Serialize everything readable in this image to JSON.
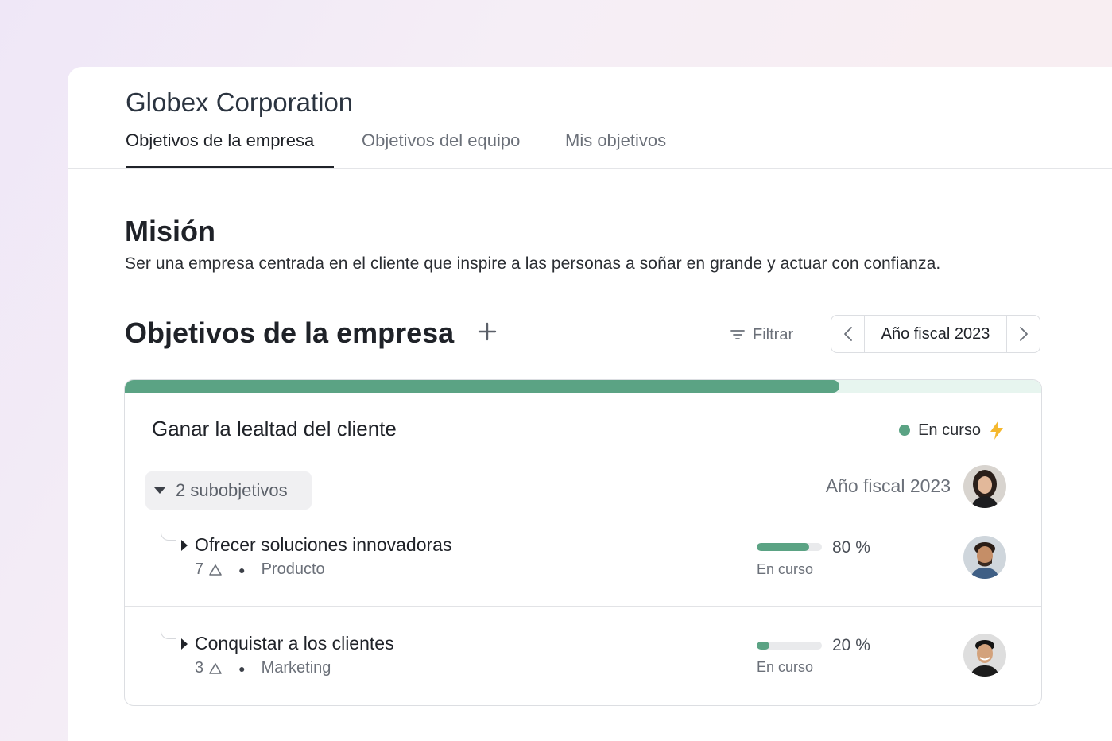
{
  "header": {
    "company": "Globex Corporation",
    "tabs": [
      {
        "label": "Objetivos de la empresa",
        "active": true
      },
      {
        "label": "Objetivos del equipo",
        "active": false
      },
      {
        "label": "Mis objetivos",
        "active": false
      }
    ]
  },
  "mission": {
    "title": "Misión",
    "text": "Ser una empresa centrada en el cliente que inspire a las personas a soñar en grande y actuar con confianza."
  },
  "goals_section": {
    "title": "Objetivos de la empresa",
    "add_icon": "plus-icon",
    "filter_label": "Filtrar",
    "filter_icon": "filter-icon",
    "period_label": "Año fiscal 2023"
  },
  "goal": {
    "title": "Ganar la lealtad del cliente",
    "progress": 0.78,
    "status": "En curso",
    "status_color": "#5ba384",
    "status_icon": "lightning-icon",
    "subgoals_label": "2 subobjetivos",
    "period": "Año fiscal 2023",
    "subgoals": [
      {
        "title": "Ofrecer soluciones innovadoras",
        "count": "7",
        "team": "Producto",
        "progress": 0.8,
        "percent": "80 %",
        "status": "En curso"
      },
      {
        "title": "Conquistar a los clientes",
        "count": "3",
        "team": "Marketing",
        "progress": 0.2,
        "percent": "20 %",
        "status": "En curso"
      }
    ]
  },
  "colors": {
    "accent_green": "#5ba384",
    "progress_track": "#e7f5ef",
    "lightning": "#f5b82e"
  }
}
